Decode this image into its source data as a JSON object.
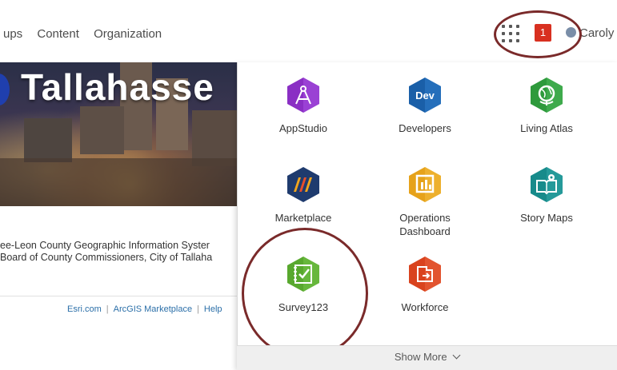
{
  "nav": {
    "items": [
      "ups",
      "Content",
      "Organization"
    ]
  },
  "header": {
    "notification_count": "1",
    "user_name": "Caroly",
    "apps_icon": "app-launcher-grid-icon"
  },
  "banner": {
    "title": "Tallahasse"
  },
  "credit": {
    "line1": "ee-Leon County Geographic Information Syster",
    "line2": "Board of County Commissioners, City of Tallaha"
  },
  "footer": {
    "links": [
      "Esri.com",
      "ArcGIS Marketplace",
      "Help"
    ],
    "separator": "|"
  },
  "apps": [
    {
      "label": "AppStudio",
      "icon": "appstudio-icon",
      "color": "#8a2fc4"
    },
    {
      "label": "Developers",
      "icon": "developers-icon",
      "color": "#1a5fa8"
    },
    {
      "label": "Living Atlas",
      "icon": "living-atlas-icon",
      "color": "#2e9a3c"
    },
    {
      "label": "Marketplace",
      "icon": "marketplace-icon",
      "color": "#1f3b6e"
    },
    {
      "label": "Operations\nDashboard",
      "icon": "operations-dashboard-icon",
      "color": "#e6a21a"
    },
    {
      "label": "Story Maps",
      "icon": "story-maps-icon",
      "color": "#178b8b"
    },
    {
      "label": "Survey123",
      "icon": "survey123-icon",
      "color": "#58a82e"
    },
    {
      "label": "Workforce",
      "icon": "workforce-icon",
      "color": "#d9431e"
    }
  ],
  "show_more": "Show More",
  "colors": {
    "callout": "#7a2a2a",
    "notification": "#d83020",
    "link": "#2b6fa8"
  }
}
